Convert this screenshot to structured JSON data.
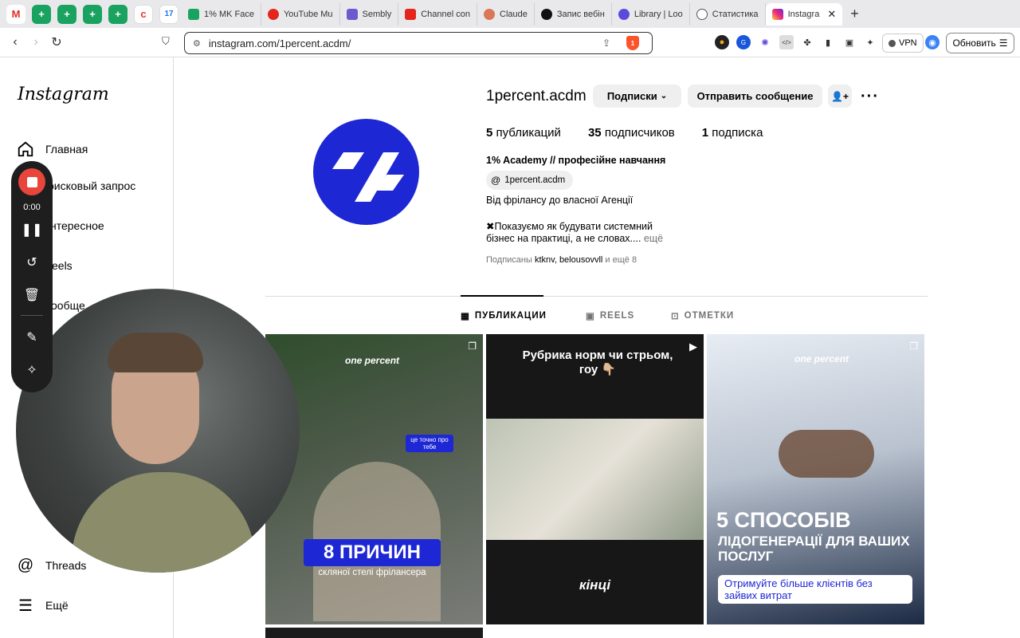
{
  "browser": {
    "tabs": [
      {
        "label": "1% MK Face",
        "color": "#1aa260"
      },
      {
        "label": "YouTube Mu",
        "color": "#e4251d"
      },
      {
        "label": "Sembly",
        "color": "#6a5acd"
      },
      {
        "label": "Channel con",
        "color": "#e4251d"
      },
      {
        "label": "Claude",
        "color": "#d97757"
      },
      {
        "label": "Запис вебін",
        "color": "#111111"
      },
      {
        "label": "Library | Loo",
        "color": "#5b4bdb"
      },
      {
        "label": "Статистика",
        "color": "#555555"
      },
      {
        "label": "Instagra",
        "color": "#d6249f"
      }
    ],
    "url": "instagram.com/1percent.acdm/",
    "vpn_label": "VPN",
    "update_label": "Обновить",
    "brave_badge": "1"
  },
  "sidebar": {
    "logo": "Instagram",
    "items": [
      {
        "label": "Главная"
      },
      {
        "label": "оисковый запрос"
      },
      {
        "label": "нтересное"
      },
      {
        "label": "eels"
      },
      {
        "label": "ообще"
      },
      {
        "label": "Threads"
      },
      {
        "label": "Ещё"
      }
    ]
  },
  "recorder": {
    "time": "0:00"
  },
  "profile": {
    "username": "1percent.acdm",
    "subscribed_label": "Подписки",
    "message_label": "Отправить сообщение",
    "posts_count": "5",
    "posts_label": "публикаций",
    "followers_count": "35",
    "followers_label": "подписчиков",
    "following_count": "1",
    "following_label": "подписка",
    "full_name": "1% Academy // професійне навчання",
    "threads_handle": "1percent.acdm",
    "bio_line1": "Від фрілансу до власної Агенції",
    "bio_line2": "✖Показуємо як будувати системний",
    "bio_line3": "бізнес на практиці, а не словах....",
    "more": "ещё",
    "followed_by_prefix": "Подписаны",
    "followed_by_names": "ktknv, belousovvll",
    "followed_by_suffix": "и ещё 8"
  },
  "profile_tabs": [
    "ПУБЛИКАЦИИ",
    "REELS",
    "ОТМЕТКИ"
  ],
  "posts": [
    {
      "brand": "one percent",
      "badge": "це точно про тебе",
      "title": "8 ПРИЧИН",
      "subtitle": "скляної стелі фрілансера"
    },
    {
      "top_text": "Рубрика норм чи стрьом, гоу 👇🏼",
      "bottom_text": "кінці"
    },
    {
      "brand": "one percent",
      "title": "5 СПОСОБІВ",
      "subtitle": "ЛІДОГЕНЕРАЦІЇ ДЛЯ ВАШИХ ПОСЛУГ",
      "cta": "Отримуйте більше клієнтів без зайвих витрат"
    }
  ]
}
